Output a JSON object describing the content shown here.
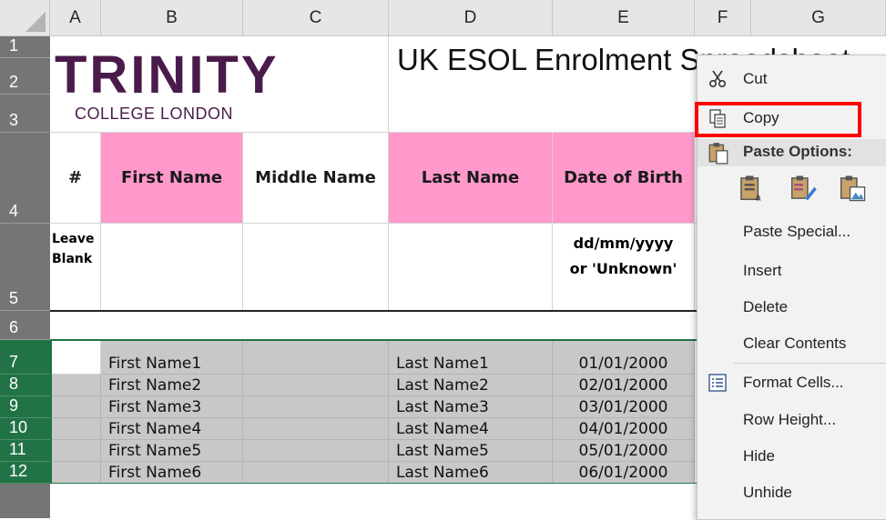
{
  "columns": [
    "A",
    "B",
    "C",
    "D",
    "E",
    "F",
    "G"
  ],
  "rows": [
    "1",
    "2",
    "3",
    "4",
    "5",
    "6",
    "7",
    "8",
    "9",
    "10",
    "11",
    "12"
  ],
  "logo": {
    "word": "TRINITY",
    "sub": "COLLEGE LONDON"
  },
  "title": "UK ESOL Enrolment Spreadsheet",
  "headers": {
    "num": "#",
    "first": "First Name",
    "middle": "Middle Name",
    "last": "Last Name",
    "dob": "Date of Birth"
  },
  "instructions": {
    "num_line1": "Leave",
    "num_line2": "Blank",
    "dob_line1": "dd/mm/yyyy",
    "dob_line2": "or 'Unknown'"
  },
  "data_rows": [
    {
      "first": "First Name1",
      "last": "Last Name1",
      "dob": "01/01/2000"
    },
    {
      "first": "First Name2",
      "last": "Last Name2",
      "dob": "02/01/2000"
    },
    {
      "first": "First Name3",
      "last": "Last Name3",
      "dob": "03/01/2000"
    },
    {
      "first": "First Name4",
      "last": "Last Name4",
      "dob": "04/01/2000"
    },
    {
      "first": "First Name5",
      "last": "Last Name5",
      "dob": "05/01/2000"
    },
    {
      "first": "First Name6",
      "last": "Last Name6",
      "dob": "06/01/2000"
    }
  ],
  "context_menu": {
    "cut": "Cut",
    "copy": "Copy",
    "paste_options": "Paste Options:",
    "paste_special": "Paste Special...",
    "insert": "Insert",
    "delete": "Delete",
    "clear_contents": "Clear Contents",
    "format_cells": "Format Cells...",
    "row_height": "Row Height...",
    "hide": "Hide",
    "unhide": "Unhide"
  },
  "colors": {
    "header_pink": "#ff99cc",
    "selection_green": "#217346",
    "logo_purple": "#4a1b4a",
    "highlight_red": "#ff0000"
  }
}
